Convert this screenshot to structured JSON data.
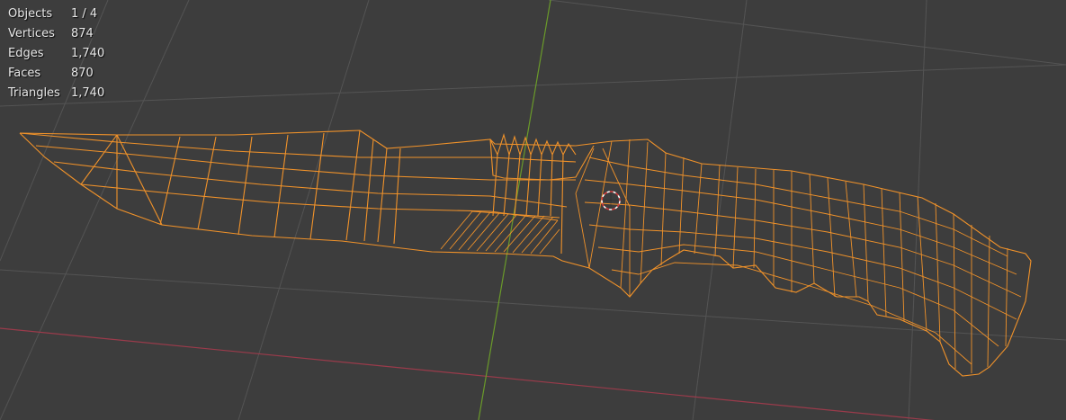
{
  "stats": [
    {
      "label": "Objects",
      "value": "1 / 4"
    },
    {
      "label": "Vertices",
      "value": "874"
    },
    {
      "label": "Edges",
      "value": "1,740"
    },
    {
      "label": "Faces",
      "value": "870"
    },
    {
      "label": "Triangles",
      "value": "1,740"
    }
  ],
  "colors": {
    "background": "#3d3d3d",
    "grid": "#545454",
    "x_axis": "#9a3b4b",
    "y_axis": "#6a9a2a",
    "wireframe": "#f0922a",
    "origin": "#d33b3b"
  },
  "icons": {
    "cursor": "3d-cursor-icon"
  }
}
